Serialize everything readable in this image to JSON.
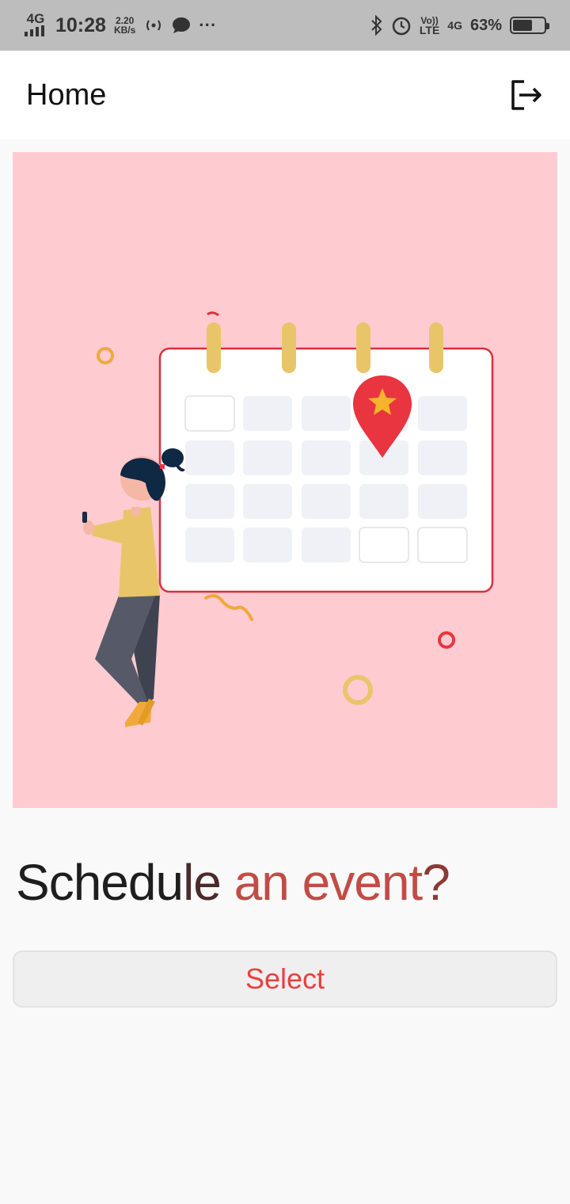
{
  "status_bar": {
    "network": "4G",
    "time": "10:28",
    "speed_value": "2.20",
    "speed_unit": "KB/s",
    "more": "···",
    "volte_top": "Vo))",
    "volte_bottom": "LTE",
    "signal2": "4G",
    "battery_percent": "63%",
    "battery_level": 0.63
  },
  "app_bar": {
    "title": "Home",
    "logout_icon": "logout-icon"
  },
  "hero": {
    "colors": {
      "background": "#fecbd1",
      "calendar_border": "#d6313c",
      "calendar_fill": "#ffffff",
      "cell": "#eff1f6",
      "ring": "#e9c56a",
      "pin": "#e8353f",
      "star": "#f6b32c"
    }
  },
  "main": {
    "headline_part1": "Schedu",
    "headline_part2": "le ",
    "headline_part3": "an event",
    "headline_part4": "?",
    "select_label": "Select"
  },
  "colors": {
    "accent": "#e8403f",
    "status_bar_bg": "#bdbdbd"
  }
}
